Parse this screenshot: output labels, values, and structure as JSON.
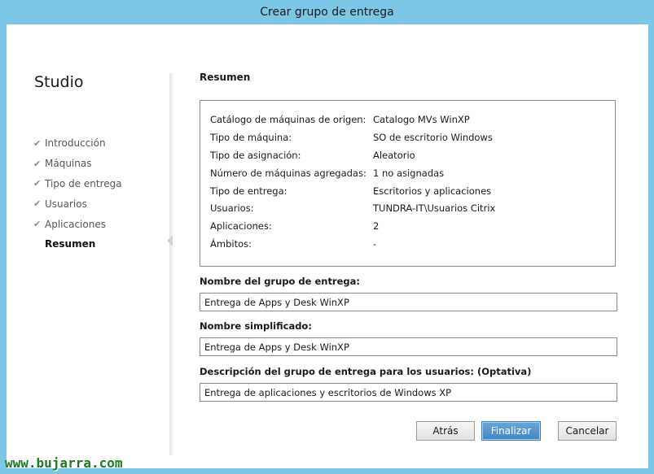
{
  "window": {
    "title": "Crear grupo de entrega"
  },
  "sidebar": {
    "title": "Studio",
    "steps": [
      {
        "label": "Introducción",
        "completed": true
      },
      {
        "label": "Máquinas",
        "completed": true
      },
      {
        "label": "Tipo de entrega",
        "completed": true
      },
      {
        "label": "Usuarios",
        "completed": true
      },
      {
        "label": "Aplicaciones",
        "completed": true
      },
      {
        "label": "Resumen",
        "completed": false,
        "current": true
      }
    ],
    "check_icon": "checkmark-icon"
  },
  "main": {
    "title": "Resumen",
    "summary": [
      {
        "label": "Catálogo de máquinas de origen:",
        "value": "Catalogo MVs WinXP"
      },
      {
        "label": "Tipo de máquina:",
        "value": "SO de escritorio Windows"
      },
      {
        "label": "Tipo de asignación:",
        "value": "Aleatorio"
      },
      {
        "label": "Número de máquinas agregadas:",
        "value": "1 no asignadas"
      },
      {
        "label": "Tipo de entrega:",
        "value": "Escritorios y aplicaciones"
      },
      {
        "label": "Usuarios:",
        "value": "TUNDRA-IT\\Usuarios Citrix"
      },
      {
        "label": "Aplicaciones:",
        "value": "2"
      },
      {
        "label": "Ámbitos:",
        "value": "-"
      }
    ],
    "fields": {
      "group_name": {
        "label": "Nombre del grupo de entrega:",
        "value": "Entrega de Apps y Desk WinXP"
      },
      "simple_name": {
        "label": "Nombre simplificado:",
        "value": "Entrega de Apps y Desk WinXP"
      },
      "description": {
        "label": "Descripción del grupo de entrega para los usuarios: (Optativa)",
        "value": "Entrega de aplicaciones y escritorios de Windows XP"
      }
    }
  },
  "buttons": {
    "back": "Atrás",
    "finish": "Finalizar",
    "cancel": "Cancelar"
  },
  "watermark": "www.bujarra.com",
  "colors": {
    "titlebar": "#7cc7e8",
    "primary_button": "#3f86c2",
    "watermark": "#1e7a1e"
  }
}
